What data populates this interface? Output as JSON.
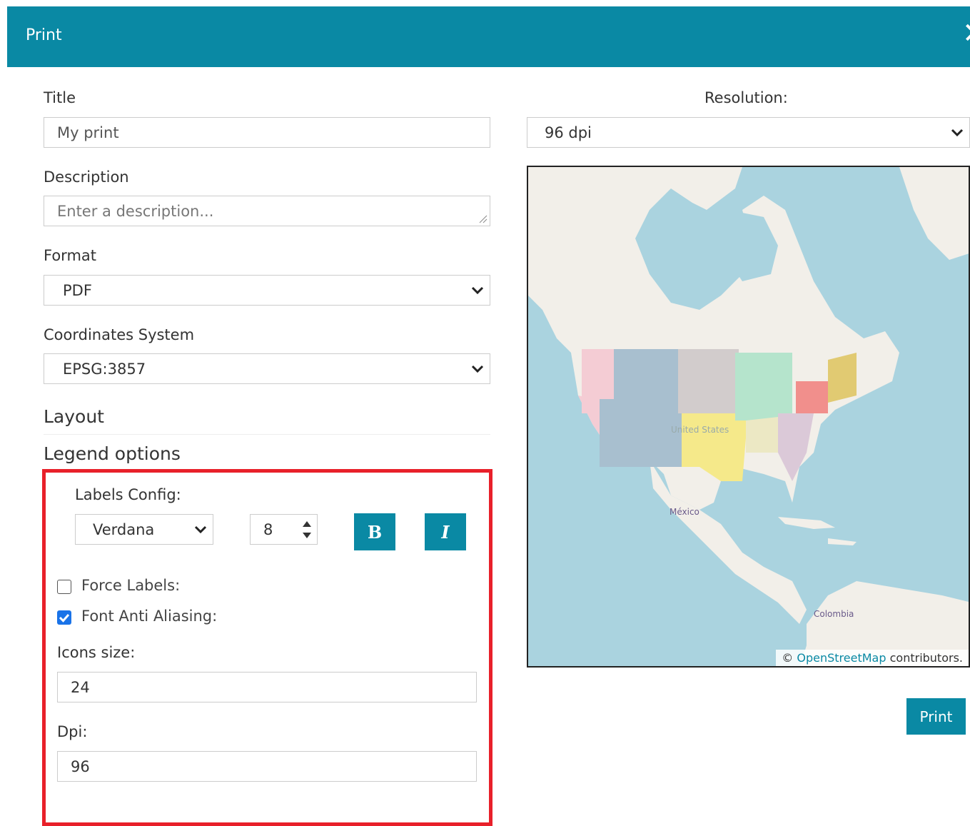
{
  "dialog": {
    "title": "Print",
    "close_icon": "close-icon"
  },
  "form": {
    "title_label": "Title",
    "title_value": "My print",
    "description_label": "Description",
    "description_placeholder": "Enter a description...",
    "format_label": "Format",
    "format_value": "PDF",
    "crs_label": "Coordinates System",
    "crs_value": "EPSG:3857"
  },
  "sections": {
    "layout": "Layout",
    "legend_options": "Legend options"
  },
  "legend": {
    "labels_config_label": "Labels Config:",
    "font_family": "Verdana",
    "font_size": "8",
    "bold_label": "B",
    "italic_label": "I",
    "force_labels_label": "Force Labels:",
    "force_labels_checked": false,
    "anti_aliasing_label": "Font Anti Aliasing:",
    "anti_aliasing_checked": true,
    "icons_size_label": "Icons size:",
    "icons_size_value": "24",
    "dpi_label": "Dpi:",
    "dpi_value": "96"
  },
  "preview": {
    "resolution_label": "Resolution:",
    "resolution_value": "96 dpi",
    "map_labels": {
      "us": "United States",
      "mexico": "México",
      "colombia": "Colombia"
    },
    "attribution_prefix": "©",
    "attribution_link": "OpenStreetMap",
    "attribution_suffix": "contributors."
  },
  "actions": {
    "print_label": "Print"
  },
  "colors": {
    "accent": "#0a89a4",
    "highlight": "#e8202a",
    "water": "#aad3df",
    "land": "#f2efe9"
  }
}
